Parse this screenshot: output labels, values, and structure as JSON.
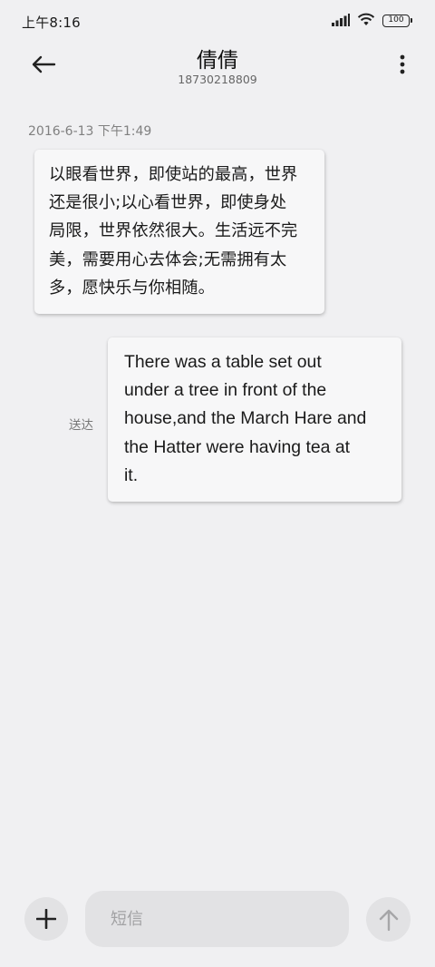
{
  "status_bar": {
    "time": "上午8:16",
    "battery": "100",
    "icons": [
      "signal-icon",
      "wifi-icon",
      "battery-icon"
    ]
  },
  "header": {
    "contact_name": "倩倩",
    "phone_number": "18730218809",
    "back_icon": "arrow-left-icon",
    "more_icon": "more-vertical-icon"
  },
  "conversation": {
    "timestamp": "2016-6-13 下午1:49",
    "messages": [
      {
        "direction": "incoming",
        "lines": [
          "以眼看世界，即使站的最高，世界",
          "还是很小;以心看世界，即使身处",
          "局限，世界依然很大。生活远不完",
          "美，需要用心去体会;无需拥有太",
          "多，愿快乐与你相随。"
        ]
      },
      {
        "direction": "outgoing",
        "status": "送达",
        "lines": [
          "There was a table set out",
          "under a tree in front of the",
          "house,and the March Hare and",
          "the Hatter were having tea at",
          "it."
        ]
      }
    ]
  },
  "composer": {
    "placeholder": "短信",
    "value": "",
    "add_icon": "plus-icon",
    "send_icon": "arrow-up-icon"
  },
  "colors": {
    "background": "#f0f0f2",
    "bubble": "#f7f7f8",
    "control": "#e2e2e4",
    "send_arrow_disabled": "#a6a6a8"
  }
}
